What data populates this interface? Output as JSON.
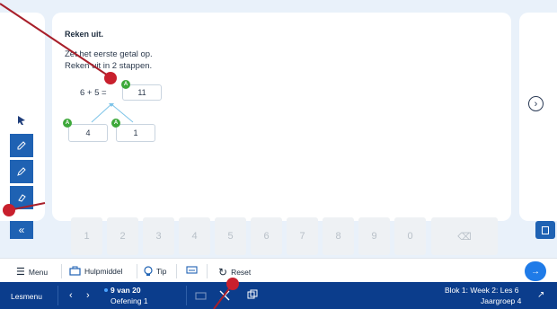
{
  "exercise": {
    "title": "Reken uit.",
    "instruction_1": "Zet het eerste getal op.",
    "instruction_2": "Reken uit in 2 stappen.",
    "expression": "6 + 5 =",
    "answer": "11",
    "split_left": "4",
    "split_right": "1",
    "badge": "A"
  },
  "keypad": {
    "keys": [
      "1",
      "2",
      "3",
      "4",
      "5",
      "6",
      "7",
      "8",
      "9",
      "0"
    ],
    "backspace": "⌫"
  },
  "bottombar": {
    "menu_label": "Menu",
    "hulpmiddel_label": "Hulpmiddel",
    "tip_label": "Tip",
    "reset_label": "Reset"
  },
  "footer": {
    "lesmenu_label": "Lesmenu",
    "counter": "9 van 20",
    "exercise_name": "Oefening 1",
    "lesson": "Blok 1: Week 2: Les 6",
    "grade": "Jaargroep 4"
  },
  "colors": {
    "primary": "#1f62b3",
    "footer": "#0b3d8c",
    "badge": "#3da83a",
    "annotation": "#c8202d"
  }
}
